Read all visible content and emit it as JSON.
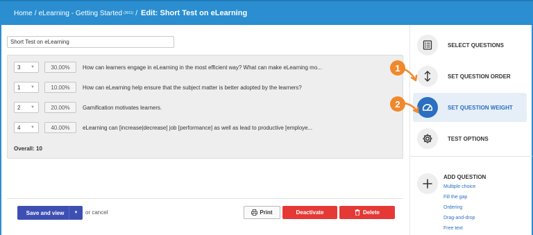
{
  "breadcrumb": {
    "home": "Home",
    "separator": "/",
    "course": "eLearning - Getting Started",
    "course_id": "(3011)",
    "edit_title": "Edit: Short Test on eLearning"
  },
  "test_title_value": "Short Test on eLearning",
  "questions": [
    {
      "order": "3",
      "weight": "30.00%",
      "text": "How can learners engage in eLearning in the most efficient way? What can make eLearning mo..."
    },
    {
      "order": "1",
      "weight": "10.00%",
      "text": "How can eLearning help ensure that the subject matter is better adopted by the learners?"
    },
    {
      "order": "2",
      "weight": "20.00%",
      "text": "Gamification motivates learners."
    },
    {
      "order": "4",
      "weight": "40.00%",
      "text": "eLearning can [increase|decrease] job [performance] as well as lead to productive [employe..."
    }
  ],
  "overall": "Overall: 10",
  "footer": {
    "save_label": "Save and view",
    "or_text": "or",
    "cancel_label": "cancel",
    "print_label": "Print",
    "deactivate_label": "Deactivate",
    "delete_label": "Delete"
  },
  "sidebar": {
    "items": [
      {
        "label": "SELECT QUESTIONS",
        "icon": "list-icon"
      },
      {
        "label": "SET QUESTION ORDER",
        "icon": "vertical-arrows-icon"
      },
      {
        "label": "SET QUESTION WEIGHT",
        "icon": "gauge-icon",
        "active": true
      },
      {
        "label": "TEST OPTIONS",
        "icon": "gear-icon"
      }
    ],
    "add_question": {
      "title": "ADD QUESTION",
      "links": [
        "Multiple choice",
        "Fill the gap",
        "Ordering",
        "Drag-and-drop",
        "Free text"
      ]
    }
  },
  "callouts": [
    "1",
    "2"
  ],
  "colors": {
    "header": "#2a8ed0",
    "accent_blue": "#2a6fc0",
    "save_button": "#3d4fb3",
    "danger": "#e53935",
    "callout": "#f0892c"
  }
}
